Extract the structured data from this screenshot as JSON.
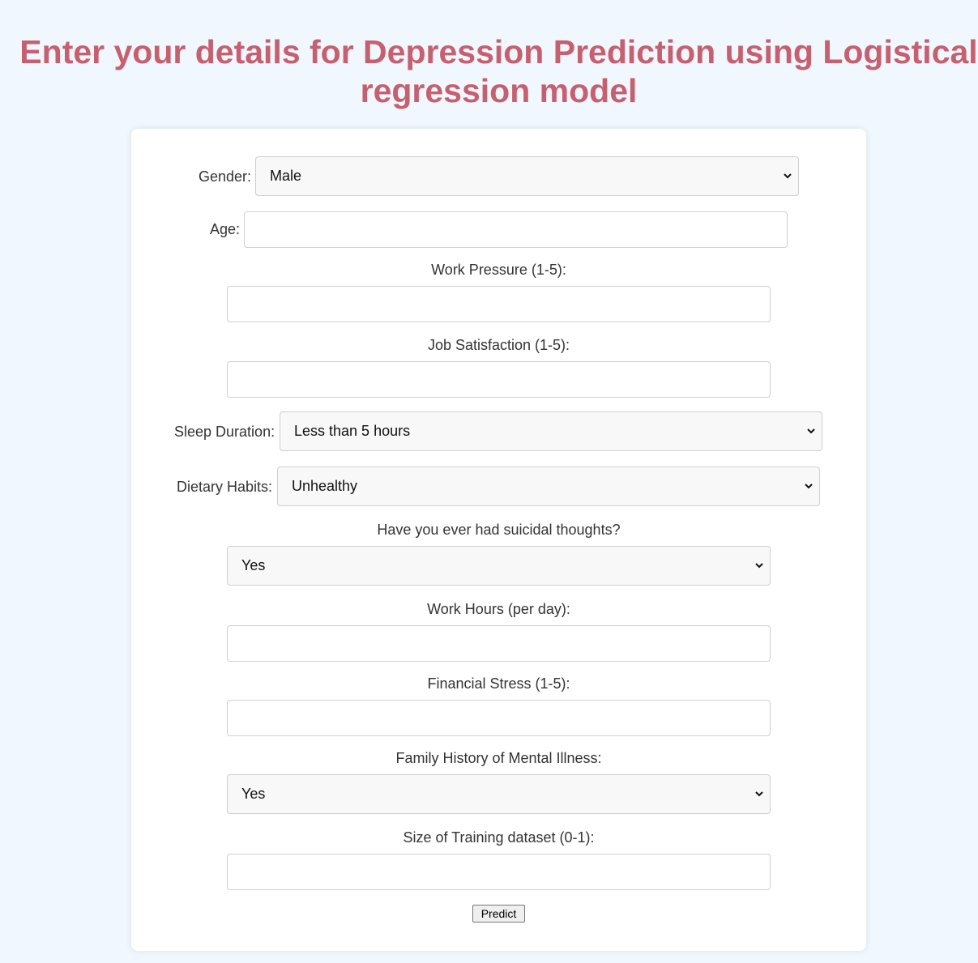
{
  "page": {
    "title": "Enter your details for Depression Prediction using Logistical regression model"
  },
  "form": {
    "gender": {
      "label": "Gender:",
      "value": "Male"
    },
    "age": {
      "label": "Age:",
      "value": "",
      "placeholder": ""
    },
    "work_pressure": {
      "label": "Work Pressure (1-5):",
      "value": "",
      "placeholder": ""
    },
    "job_satisfaction": {
      "label": "Job Satisfaction (1-5):",
      "value": "",
      "placeholder": ""
    },
    "sleep_duration": {
      "label": "Sleep Duration:",
      "value": "Less than 5 hours"
    },
    "dietary_habits": {
      "label": "Dietary Habits:",
      "value": "Unhealthy"
    },
    "suicidal_thoughts": {
      "label": "Have you ever had suicidal thoughts?",
      "value": "Yes"
    },
    "work_hours": {
      "label": "Work Hours (per day):",
      "value": "",
      "placeholder": ""
    },
    "financial_stress": {
      "label": "Financial Stress (1-5):",
      "value": "",
      "placeholder": ""
    },
    "family_history": {
      "label": "Family History of Mental Illness:",
      "value": "Yes"
    },
    "training_size": {
      "label": "Size of Training dataset (0-1):",
      "value": "",
      "placeholder": ""
    },
    "submit_label": "Predict"
  },
  "colors": {
    "title": "#c6606f",
    "background": "#f0f7ff",
    "card": "#ffffff",
    "select_background": "#f8f8f8"
  },
  "icons": {
    "dropdown": "chevron-down-icon"
  }
}
